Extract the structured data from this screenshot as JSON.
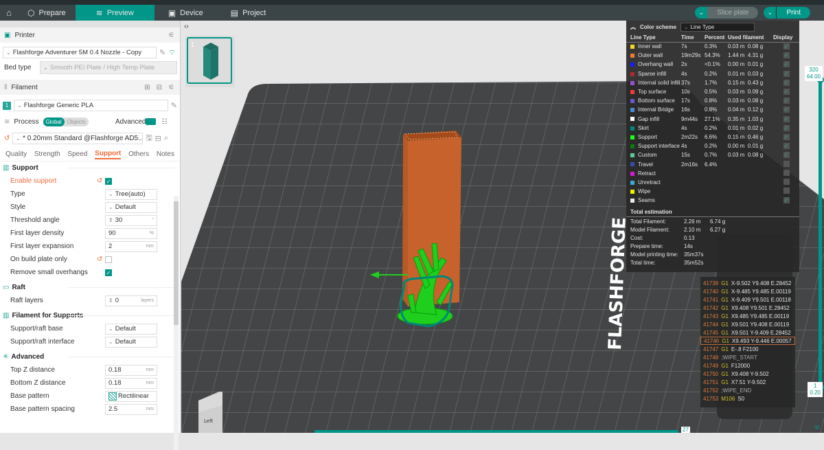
{
  "nav": {
    "tabs": [
      {
        "label": "Prepare",
        "icon": "cube-icon"
      },
      {
        "label": "Preview",
        "icon": "layers-icon",
        "active": true
      },
      {
        "label": "Device",
        "icon": "monitor-icon"
      },
      {
        "label": "Project",
        "icon": "document-icon"
      }
    ],
    "slice_label": "Slice plate",
    "print_label": "Print"
  },
  "printer": {
    "title": "Printer",
    "selected": "Flashforge Adventurer 5M 0.4 Nozzle - Copy",
    "bed_type_label": "Bed type",
    "bed_type_value": "Smooth PEI Plate / High Temp Plate"
  },
  "filament": {
    "title": "Filament",
    "slot": "1",
    "selected": "Flashforge Generic PLA",
    "color": "#26a69a"
  },
  "process": {
    "title": "Process",
    "toggle_global": "Global",
    "toggle_objects": "Objects",
    "advanced_label": "Advanced",
    "preset": "* 0.20mm Standard @Flashforge AD5...",
    "tabs": [
      "Quality",
      "Strength",
      "Speed",
      "Support",
      "Others",
      "Notes"
    ],
    "active_tab": "Support"
  },
  "support": {
    "group": "Support",
    "enable_support": {
      "label": "Enable support",
      "checked": true
    },
    "type": {
      "label": "Type",
      "value": "Tree(auto)"
    },
    "style": {
      "label": "Style",
      "value": "Default"
    },
    "threshold_angle": {
      "label": "Threshold angle",
      "value": "30",
      "unit": "°"
    },
    "first_layer_density": {
      "label": "First layer density",
      "value": "90",
      "unit": "%"
    },
    "first_layer_expansion": {
      "label": "First layer expansion",
      "value": "2",
      "unit": "mm"
    },
    "on_build_plate_only": {
      "label": "On build plate only",
      "checked": false
    },
    "remove_small_overhangs": {
      "label": "Remove small overhangs",
      "checked": true
    }
  },
  "raft": {
    "group": "Raft",
    "raft_layers": {
      "label": "Raft layers",
      "value": "0",
      "unit": "layers"
    }
  },
  "filament_supports": {
    "group": "Filament for Supports",
    "base": {
      "label": "Support/raft base",
      "value": "Default"
    },
    "interface": {
      "label": "Support/raft interface",
      "value": "Default"
    }
  },
  "advanced": {
    "group": "Advanced",
    "top_z": {
      "label": "Top Z distance",
      "value": "0.18",
      "unit": "mm"
    },
    "bottom_z": {
      "label": "Bottom Z distance",
      "value": "0.18",
      "unit": "mm"
    },
    "base_pattern": {
      "label": "Base pattern",
      "value": "Rectilinear"
    },
    "base_pattern_spacing": {
      "label": "Base pattern spacing",
      "value": "2.5",
      "unit": "mm"
    }
  },
  "viewport": {
    "plate_number": "1",
    "view_cube_label": "Left",
    "logo_text": "FLASHFORGE"
  },
  "legend": {
    "color_scheme_label": "Color scheme",
    "color_scheme_value": "Line Type",
    "columns": [
      "Line Type",
      "Time",
      "Percent",
      "Used filament",
      "Display"
    ],
    "rows": [
      {
        "name": "Inner wall",
        "color": "#f5d623",
        "time": "7s",
        "percent": "0.3%",
        "length": "0.03 m",
        "weight": "0.08 g",
        "display": true
      },
      {
        "name": "Outer wall",
        "color": "#f07c2c",
        "time": "19m29s",
        "percent": "54.3%",
        "length": "1.44 m",
        "weight": "4.31 g",
        "display": true
      },
      {
        "name": "Overhang wall",
        "color": "#1a1aff",
        "time": "2s",
        "percent": "<0.1%",
        "length": "0.00 m",
        "weight": "0.01 g",
        "display": true
      },
      {
        "name": "Sparse infill",
        "color": "#b02a2a",
        "time": "4s",
        "percent": "0.2%",
        "length": "0.01 m",
        "weight": "0.03 g",
        "display": true
      },
      {
        "name": "Internal solid infill",
        "color": "#9a4fd0",
        "time": "37s",
        "percent": "1.7%",
        "length": "0.15 m",
        "weight": "0.43 g",
        "display": true
      },
      {
        "name": "Top surface",
        "color": "#f03a3a",
        "time": "10s",
        "percent": "0.5%",
        "length": "0.03 m",
        "weight": "0.09 g",
        "display": true
      },
      {
        "name": "Bottom surface",
        "color": "#6a5acd",
        "time": "17s",
        "percent": "0.8%",
        "length": "0.03 m",
        "weight": "0.08 g",
        "display": true
      },
      {
        "name": "Internal Bridge",
        "color": "#4a8ad4",
        "time": "16s",
        "percent": "0.8%",
        "length": "0.04 m",
        "weight": "0.12 g",
        "display": true
      },
      {
        "name": "Gap infill",
        "color": "#ffffff",
        "time": "9m44s",
        "percent": "27.1%",
        "length": "0.35 m",
        "weight": "1.03 g",
        "display": true
      },
      {
        "name": "Skirt",
        "color": "#00877a",
        "time": "4s",
        "percent": "0.2%",
        "length": "0.01 m",
        "weight": "0.02 g",
        "display": true
      },
      {
        "name": "Support",
        "color": "#1aff1a",
        "time": "2m22s",
        "percent": "6.6%",
        "length": "0.15 m",
        "weight": "0.46 g",
        "display": true
      },
      {
        "name": "Support interface",
        "color": "#0a7a0a",
        "time": "4s",
        "percent": "0.2%",
        "length": "0.00 m",
        "weight": "0.01 g",
        "display": true
      },
      {
        "name": "Custom",
        "color": "#5ec99a",
        "time": "15s",
        "percent": "0.7%",
        "length": "0.03 m",
        "weight": "0.08 g",
        "display": true
      },
      {
        "name": "Travel",
        "color": "#3a4ab0",
        "time": "2m16s",
        "percent": "6.4%",
        "length": "",
        "weight": "",
        "display": false
      },
      {
        "name": "Retract",
        "color": "#d41ad4",
        "time": "",
        "percent": "",
        "length": "",
        "weight": "",
        "display": false
      },
      {
        "name": "Unretract",
        "color": "#3aaad4",
        "time": "",
        "percent": "",
        "length": "",
        "weight": "",
        "display": false
      },
      {
        "name": "Wipe",
        "color": "#f0f000",
        "time": "",
        "percent": "",
        "length": "",
        "weight": "",
        "display": false
      },
      {
        "name": "Seams",
        "color": "#e8e8e8",
        "time": "",
        "percent": "",
        "length": "",
        "weight": "",
        "display": true
      }
    ],
    "total_title": "Total estimation",
    "totals": [
      {
        "label": "Total Filament:",
        "v1": "2.26 m",
        "v2": "6.74 g"
      },
      {
        "label": "Model Filament:",
        "v1": "2.10 m",
        "v2": "6.27 g"
      },
      {
        "label": "Cost:",
        "v1": "0.13",
        "v2": ""
      },
      {
        "label": "Prepare time:",
        "v1": "14s",
        "v2": ""
      },
      {
        "label": "Model printing time:",
        "v1": "35m37s",
        "v2": ""
      },
      {
        "label": "Total time:",
        "v1": "35m52s",
        "v2": ""
      }
    ]
  },
  "gcode": [
    {
      "n": "41739",
      "cmd": "G1",
      "args": "X-9.502 Y9.408 E.28452"
    },
    {
      "n": "41740",
      "cmd": "G1",
      "args": "X-9.485 Y9.485 E.00119"
    },
    {
      "n": "41741",
      "cmd": "G1",
      "args": "X-9.409 Y9.501 E.00118"
    },
    {
      "n": "41742",
      "cmd": "G1",
      "args": "X9.408 Y9.501 E.28452"
    },
    {
      "n": "41743",
      "cmd": "G1",
      "args": "X9.485 Y9.485 E.00119"
    },
    {
      "n": "41744",
      "cmd": "G1",
      "args": "X9.501 Y9.408 E.00119"
    },
    {
      "n": "41745",
      "cmd": "G1",
      "args": "X9.501 Y-9.409 E.28452"
    },
    {
      "n": "41746",
      "cmd": "G1",
      "args": "X9.493 Y-9.446 E.00057",
      "selected": true
    },
    {
      "n": "41747",
      "cmd": "G1",
      "args": "E-.8 F2100"
    },
    {
      "n": "41748",
      "cmd": "",
      "args": ";WIPE_START"
    },
    {
      "n": "41749",
      "cmd": "G1",
      "args": "F12000"
    },
    {
      "n": "41750",
      "cmd": "G1",
      "args": "X9.408 Y-9.502"
    },
    {
      "n": "41751",
      "cmd": "G1",
      "args": "X7.51 Y-9.502"
    },
    {
      "n": "41752",
      "cmd": "",
      "args": ";WIPE_END"
    },
    {
      "n": "41753",
      "cmd": "M106",
      "args": "S0"
    }
  ],
  "layer_slider": {
    "top_layer": "320",
    "top_height": "64.00",
    "bottom_layer": "1",
    "bottom_height": "0.20"
  },
  "move_slider": {
    "value": "27"
  }
}
